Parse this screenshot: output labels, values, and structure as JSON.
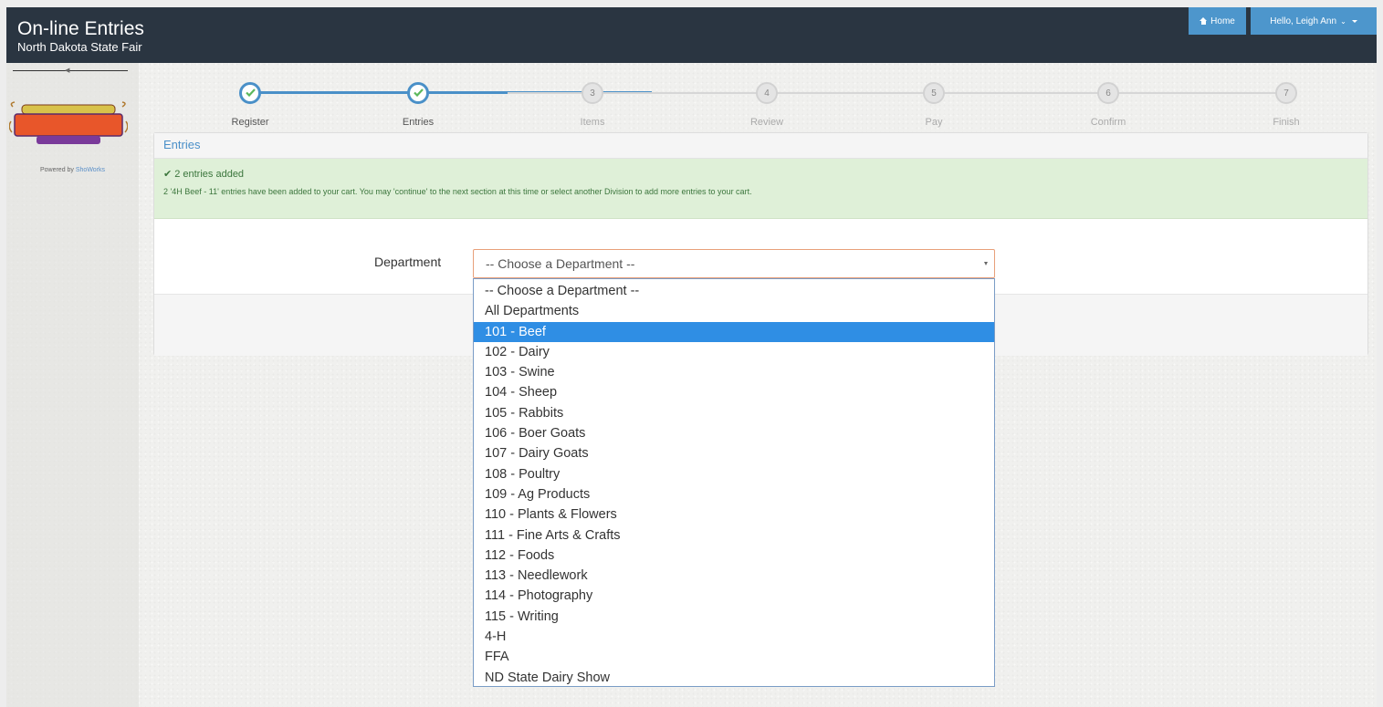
{
  "header": {
    "title": "On-line Entries",
    "subtitle": "North Dakota State Fair",
    "home_label": "Home",
    "user_label": "Hello, Leigh Ann"
  },
  "sidebar": {
    "logo_alt": "North Dakota State Fair July 20-28 2018",
    "powered_prefix": "Powered by ",
    "powered_link": "ShoWorks"
  },
  "stepper": {
    "steps": [
      {
        "label": "Register",
        "number": "1",
        "status": "done"
      },
      {
        "label": "Entries",
        "number": "2",
        "status": "done"
      },
      {
        "label": "Items",
        "number": "3",
        "status": "pending"
      },
      {
        "label": "Review",
        "number": "4",
        "status": "pending"
      },
      {
        "label": "Pay",
        "number": "5",
        "status": "pending"
      },
      {
        "label": "Confirm",
        "number": "6",
        "status": "pending"
      },
      {
        "label": "Finish",
        "number": "7",
        "status": "pending"
      }
    ]
  },
  "panel": {
    "heading": "Entries",
    "alert_title": "2 entries added",
    "alert_message": "2 '4H Beef - 11' entries have been added to your cart. You may 'continue' to the next section at this time or select another Division to add more entries to your cart.",
    "department_label": "Department",
    "department_value": "-- Choose a Department --"
  },
  "dropdown": {
    "selected_index": 2,
    "options": [
      "-- Choose a Department --",
      "All Departments",
      "101 - Beef",
      "102 - Dairy",
      "103 - Swine",
      "104 - Sheep",
      "105 - Rabbits",
      "106 - Boer Goats",
      "107 - Dairy Goats",
      "108 - Poultry",
      "109 - Ag Products",
      "110 - Plants & Flowers",
      "111 - Fine Arts & Crafts",
      "112 - Foods",
      "113 - Needlework",
      "114 - Photography",
      "115 - Writing",
      "4-H",
      "FFA",
      "ND State Dairy Show"
    ]
  },
  "colors": {
    "topbar": "#2a3541",
    "accent": "#4d96cc",
    "success_bg": "#dff0d8",
    "success_text": "#3c763d",
    "selected_option": "#2f8ee4"
  }
}
